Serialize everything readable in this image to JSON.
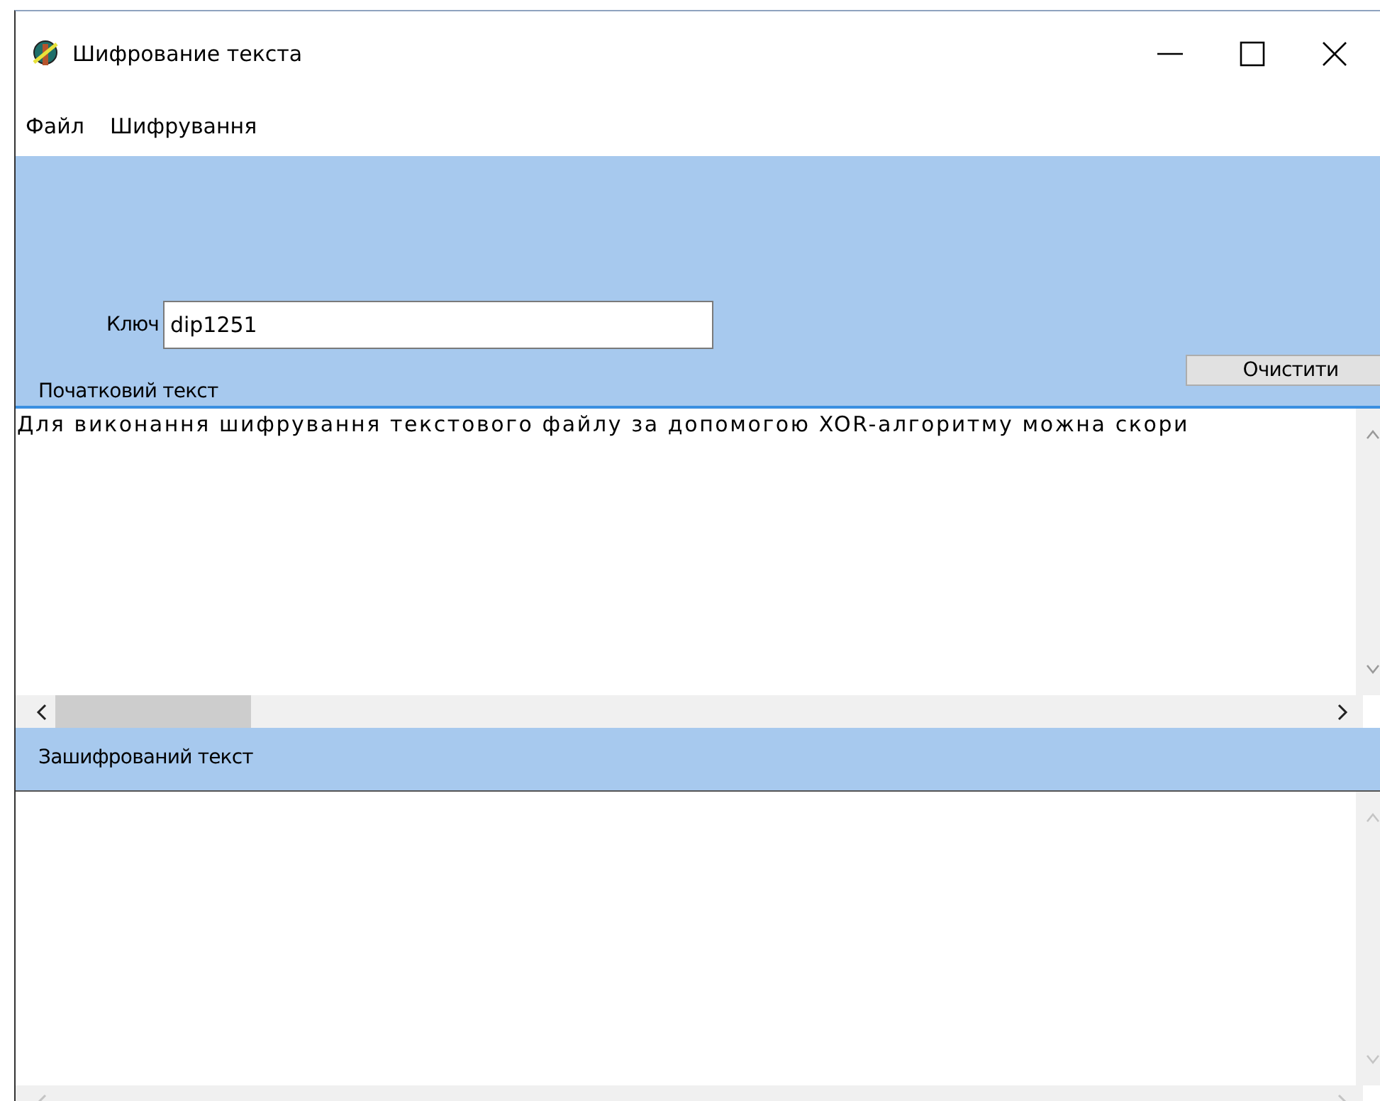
{
  "window": {
    "title": "Шифрование текста"
  },
  "menu": [
    "Файл",
    "Шифрування"
  ],
  "key_field": {
    "label": "Ключ",
    "value": "dip1251"
  },
  "clear_button": "Очистити",
  "source": {
    "label": "Початковий текст",
    "text": "Для виконання шифрування текстового файлу за допомогою XOR-алгоритму можна скори"
  },
  "encrypted": {
    "label": "Зашифрований текст"
  }
}
